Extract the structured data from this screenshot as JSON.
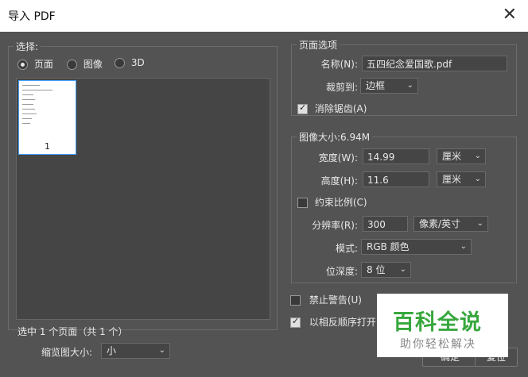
{
  "window": {
    "title": "导入 PDF"
  },
  "select": {
    "legend": "选择:",
    "options": [
      "页面",
      "图像",
      "3D"
    ],
    "page_number": "1",
    "summary": "选中 1 个页面（共 1 个）",
    "thumb_size_label": "缩览图大小:",
    "thumb_size_value": "小"
  },
  "page_options": {
    "legend": "页面选项",
    "name_label": "名称(N):",
    "name_value": "五四纪念爱国歌.pdf",
    "crop_label": "裁剪到:",
    "crop_value": "边框",
    "antialias_label": "消除锯齿(A)"
  },
  "image_size": {
    "legend": "图像大小:6.94M",
    "width_label": "宽度(W):",
    "width_value": "14.99",
    "width_unit": "厘米",
    "height_label": "高度(H):",
    "height_value": "11.6",
    "height_unit": "厘米",
    "constrain_label": "约束比例(C)",
    "resolution_label": "分辨率(R):",
    "resolution_value": "300",
    "resolution_unit": "像素/英寸",
    "mode_label": "模式:",
    "mode_value": "RGB 颜色",
    "depth_label": "位深度:",
    "depth_value": "8 位"
  },
  "options": {
    "suppress_warnings_label": "禁止警告(U)",
    "reverse_order_label": "以相反顺序打开"
  },
  "buttons": {
    "ok": "确定",
    "reset": "复位"
  },
  "watermark": {
    "title": "百科全说",
    "subtitle": "助你轻松解决"
  }
}
